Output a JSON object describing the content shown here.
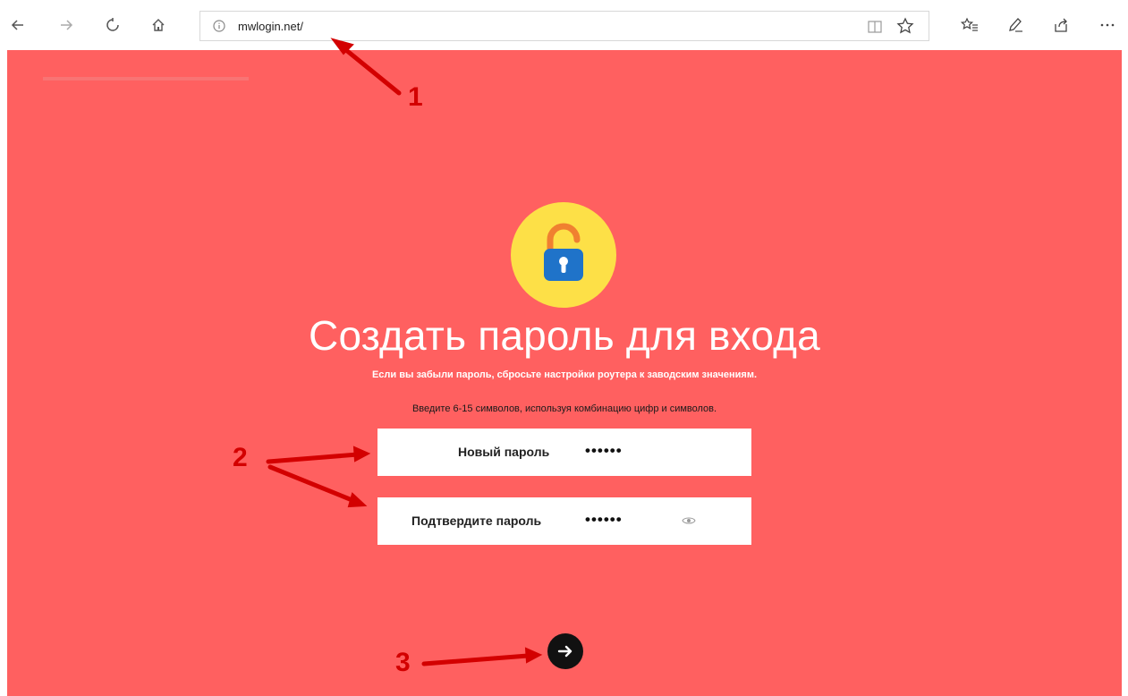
{
  "browser": {
    "url": "mwlogin.net/",
    "icons": {
      "back": "back-arrow-icon",
      "forward": "forward-arrow-icon",
      "refresh": "refresh-icon",
      "home": "home-icon",
      "info": "info-icon",
      "reader": "reading-view-icon",
      "favorite": "star-icon",
      "favorites_list": "favorites-icon",
      "pen": "pen-icon",
      "share": "share-icon",
      "more": "more-icon"
    }
  },
  "login": {
    "title": "Создать пароль для входа",
    "warning": "Если вы забыли пароль, сбросьте настройки роутера к заводским значениям.",
    "hint": "Введите 6-15 символов, используя комбинацию цифр и символов.",
    "new_password": {
      "label": "Новый пароль",
      "value": "••••••"
    },
    "confirm_password": {
      "label": "Подтвердите пароль",
      "value": "••••••"
    },
    "submit_icon": "arrow-right-icon"
  },
  "annotations": {
    "one": "1",
    "two": "2",
    "three": "3"
  },
  "colors": {
    "page_background": "#ff6060",
    "lock_circle": "#fde047",
    "lock_body": "#1f73c9",
    "lock_shackle": "#f08030",
    "annotation": "#d30000"
  }
}
